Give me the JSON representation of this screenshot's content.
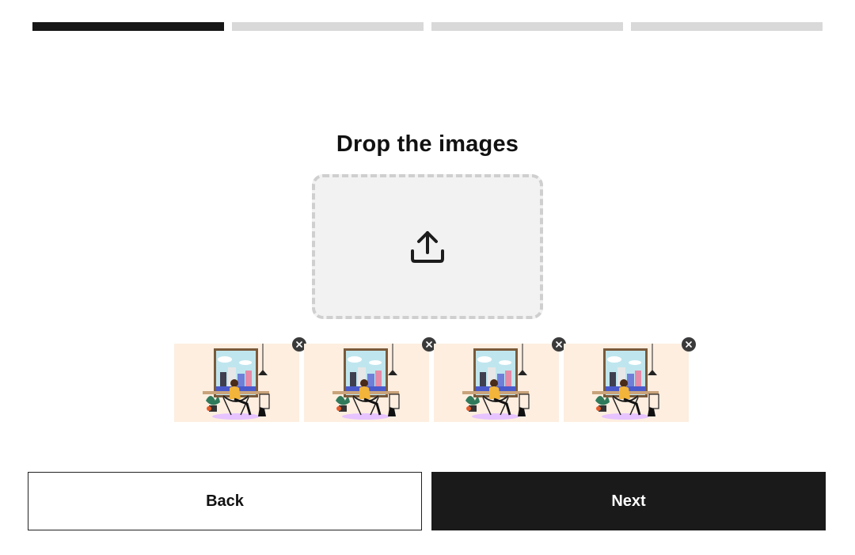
{
  "progress": {
    "steps": [
      {
        "state": "active"
      },
      {
        "state": "inactive"
      },
      {
        "state": "inactive"
      },
      {
        "state": "inactive"
      }
    ],
    "current_step": 1,
    "total_steps": 4,
    "colors": {
      "active": "#171717",
      "inactive": "#d9d9d9"
    }
  },
  "main": {
    "title": "Drop the images"
  },
  "dropzone": {
    "icon": "upload-icon",
    "background": "#f2f2f2"
  },
  "thumbnails": {
    "items": [
      {
        "image": "room-illustration",
        "remove_icon": "close-icon"
      },
      {
        "image": "room-illustration",
        "remove_icon": "close-icon"
      },
      {
        "image": "room-illustration",
        "remove_icon": "close-icon"
      },
      {
        "image": "room-illustration",
        "remove_icon": "close-icon"
      }
    ],
    "background": "#fdeee0"
  },
  "footer": {
    "back_label": "Back",
    "next_label": "Next"
  }
}
